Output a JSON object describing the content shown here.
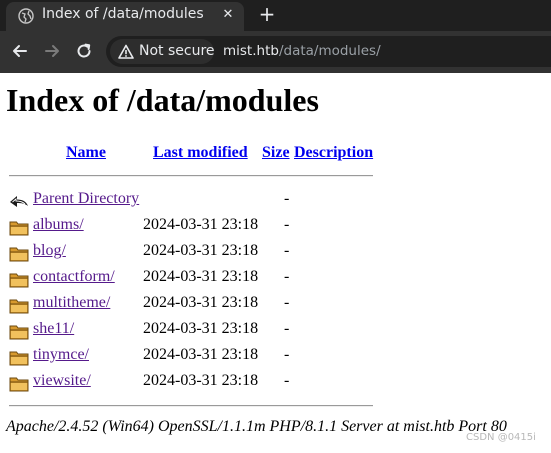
{
  "browser": {
    "tab": {
      "title": "Index of /data/modules",
      "close_icon": "close-icon"
    },
    "new_tab_icon": "plus-icon",
    "toolbar": {
      "back_icon": "arrow-left-icon",
      "forward_icon": "arrow-right-icon",
      "reload_icon": "reload-icon"
    },
    "omnibox": {
      "security_label": "Not secure",
      "url_host": "mist.htb",
      "url_path": "/data/modules/"
    },
    "colors": {
      "tabstrip": "#1f1f1f",
      "toolbar": "#323232",
      "link_visited": "#551a8b",
      "link": "#0000ee"
    }
  },
  "page": {
    "title": "Index of /data/modules",
    "columns": {
      "name": "Name",
      "last_modified": "Last modified",
      "size": "Size",
      "description": "Description"
    },
    "rows": [
      {
        "name": "Parent Directory",
        "date": "",
        "size": "-",
        "icon": "parent-directory-icon"
      },
      {
        "name": "albums/",
        "date": "2024-03-31 23:18",
        "size": "-",
        "icon": "folder-icon"
      },
      {
        "name": "blog/",
        "date": "2024-03-31 23:18",
        "size": "-",
        "icon": "folder-icon"
      },
      {
        "name": "contactform/",
        "date": "2024-03-31 23:18",
        "size": "-",
        "icon": "folder-icon"
      },
      {
        "name": "multitheme/",
        "date": "2024-03-31 23:18",
        "size": "-",
        "icon": "folder-icon"
      },
      {
        "name": "she11/",
        "date": "2024-03-31 23:18",
        "size": "-",
        "icon": "folder-icon"
      },
      {
        "name": "tinymce/",
        "date": "2024-03-31 23:18",
        "size": "-",
        "icon": "folder-icon"
      },
      {
        "name": "viewsite/",
        "date": "2024-03-31 23:18",
        "size": "-",
        "icon": "folder-icon"
      }
    ],
    "address": "Apache/2.4.52 (Win64) OpenSSL/1.1.1m PHP/8.1.1 Server at mist.htb Port 80"
  },
  "watermark": "CSDN @0415i"
}
